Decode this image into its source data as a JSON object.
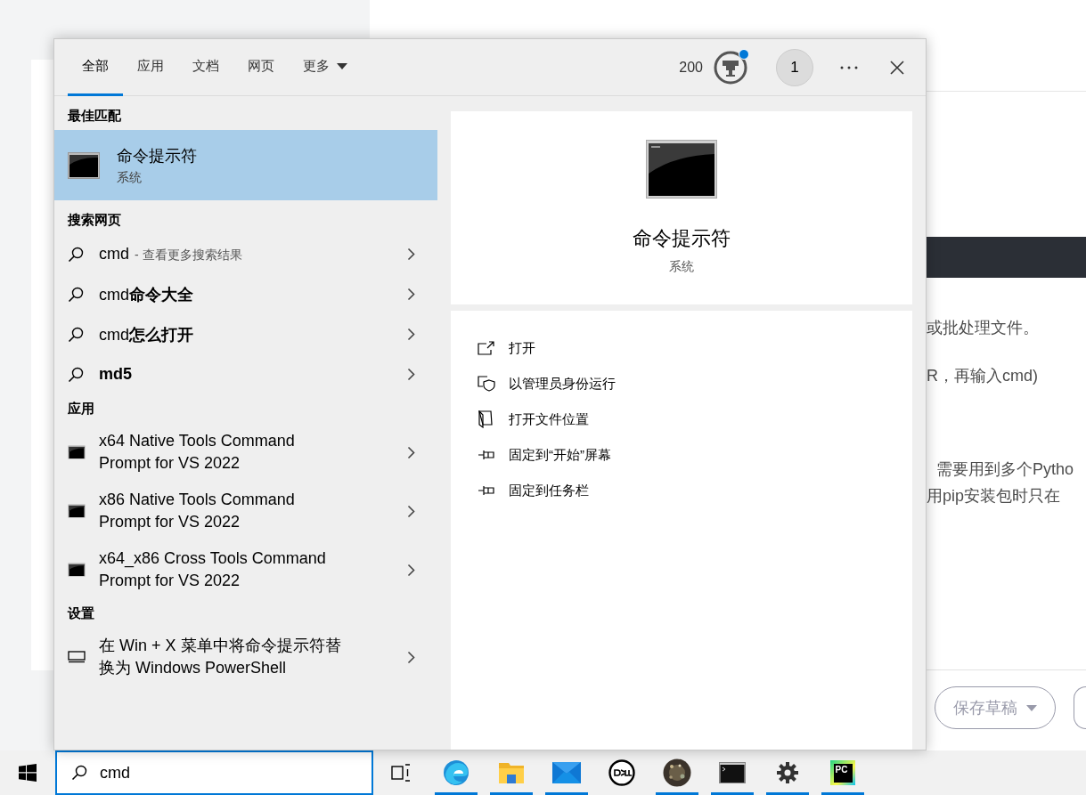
{
  "background_page": {
    "paragraphs": [
      {
        "text": "或批处理文件。",
        "indent": false
      },
      {
        "text": "R，再输入cmd)",
        "indent": false
      },
      {
        "text": "需要用到多个Pytho",
        "indent": true
      },
      {
        "text": "用pip安装包时只在",
        "indent": false
      }
    ],
    "save_button": "保存草稿"
  },
  "search_panel": {
    "tabs": [
      {
        "label": "全部",
        "selected": true,
        "dropdown": false
      },
      {
        "label": "应用",
        "selected": false,
        "dropdown": false
      },
      {
        "label": "文档",
        "selected": false,
        "dropdown": false
      },
      {
        "label": "网页",
        "selected": false,
        "dropdown": false
      },
      {
        "label": "更多",
        "selected": false,
        "dropdown": true
      }
    ],
    "points": "200",
    "notification": true,
    "account_badge": "1",
    "best_match": {
      "heading": "最佳匹配",
      "title": "命令提示符",
      "subtitle": "系统",
      "selected": true
    },
    "web": {
      "heading": "搜索网页",
      "items": [
        {
          "text": "cmd",
          "hint": "- 查看更多搜索结果",
          "selected": false
        },
        {
          "text": "cmd**命令大全**",
          "selected": false
        },
        {
          "text": "cmd**怎么打开**",
          "selected": false
        },
        {
          "text": "**md5**",
          "selected": false
        }
      ]
    },
    "apps": {
      "heading": "应用",
      "items": [
        {
          "lines": [
            "x64 Native Tools Command",
            "Prompt for VS 2022"
          ],
          "selected": false
        },
        {
          "lines": [
            "x86 Native Tools Command",
            "Prompt for VS 2022"
          ],
          "selected": false
        },
        {
          "lines": [
            "x64_x86 Cross Tools Command",
            "Prompt for VS 2022"
          ],
          "selected": false
        }
      ]
    },
    "settings": {
      "heading": "设置",
      "items": [
        {
          "lines": [
            "在 Win + X 菜单中将命令提示符替",
            "换为 Windows PowerShell"
          ],
          "selected": false
        }
      ]
    },
    "preview": {
      "title": "命令提示符",
      "subtitle": "系统",
      "actions": [
        {
          "label": "打开",
          "kind": "open"
        },
        {
          "label": "以管理员身份运行",
          "kind": "admin"
        },
        {
          "label": "打开文件位置",
          "kind": "location"
        },
        {
          "label": "固定到“开始”屏幕",
          "kind": "pin"
        },
        {
          "label": "固定到任务栏",
          "kind": "pin"
        }
      ]
    }
  },
  "taskbar": {
    "search_value": "cmd",
    "apps": [
      {
        "kind": "task-view",
        "running": false
      },
      {
        "kind": "browser",
        "running": true
      },
      {
        "kind": "folder",
        "running": true
      },
      {
        "kind": "mail",
        "running": true
      },
      {
        "kind": "logo",
        "running": false
      },
      {
        "kind": "orb",
        "running": true
      },
      {
        "kind": "terminal",
        "running": true
      },
      {
        "kind": "settings",
        "running": true
      },
      {
        "kind": "ide",
        "running": true,
        "label": "PC"
      }
    ]
  }
}
